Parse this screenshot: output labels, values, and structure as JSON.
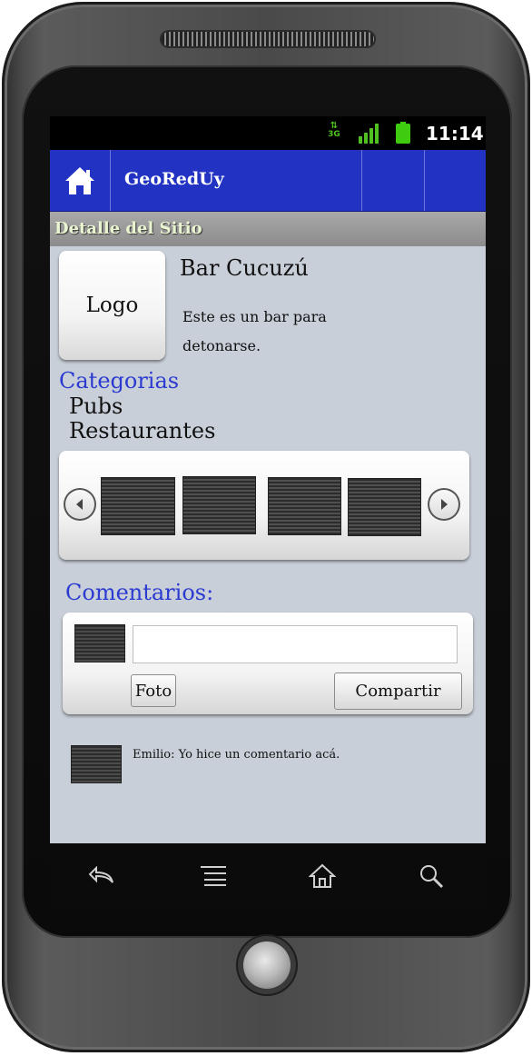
{
  "status_bar": {
    "network": "3G",
    "time": "11:14",
    "colors": {
      "network": "#4fc020",
      "battery": "#3fcc10"
    }
  },
  "action_bar": {
    "home_icon": "home-icon",
    "title": "GeoRedUy",
    "color": "#2233c4"
  },
  "section_header": "Detalle del Sitio",
  "site": {
    "logo_label": "Logo",
    "name": "Bar Cucuzú",
    "description": "Este es un bar para detonarse."
  },
  "categories": {
    "title": "Categorias",
    "items": [
      "Pubs",
      "Restaurantes"
    ]
  },
  "gallery": {
    "prev_icon": "arrow-left-icon",
    "next_icon": "arrow-right-icon",
    "image_count": 4
  },
  "comments": {
    "title": "Comentarios:",
    "input_value": "",
    "photo_button": "Foto",
    "share_button": "Compartir",
    "items": [
      {
        "text": "Emilio: Yo hice un comentario acá."
      }
    ]
  },
  "nav_bar": {
    "icons": [
      "back-icon",
      "menu-icon",
      "home-icon",
      "search-icon"
    ]
  }
}
